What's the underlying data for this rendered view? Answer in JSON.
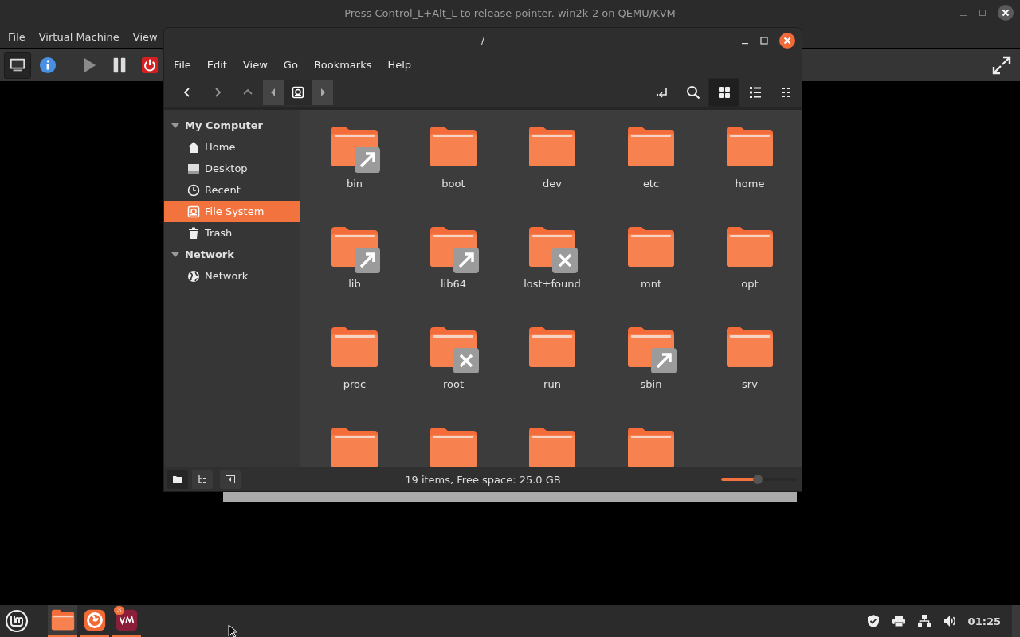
{
  "vm_window": {
    "title": "Press Control_L+Alt_L to release pointer. win2k-2 on QEMU/KVM",
    "menu": [
      "File",
      "Virtual Machine",
      "View"
    ],
    "toolbar": [
      {
        "kind": "console",
        "selected": true
      },
      {
        "kind": "info",
        "selected": false
      },
      {
        "kind": "run",
        "selected": false
      },
      {
        "kind": "pause",
        "selected": false
      },
      {
        "kind": "power",
        "selected": false
      }
    ]
  },
  "file_manager": {
    "title": "/",
    "menu": [
      "File",
      "Edit",
      "View",
      "Go",
      "Bookmarks",
      "Help"
    ],
    "view_modes": [
      {
        "kind": "icons",
        "selected": true
      },
      {
        "kind": "list",
        "selected": false
      },
      {
        "kind": "compact",
        "selected": false
      }
    ],
    "sidebar": [
      {
        "label": "My Computer",
        "expanded": true,
        "children": [
          {
            "label": "Home",
            "kind": "home",
            "selected": false
          },
          {
            "label": "Desktop",
            "kind": "desktop",
            "selected": false
          },
          {
            "label": "Recent",
            "kind": "recent",
            "selected": false
          },
          {
            "label": "File System",
            "kind": "drive",
            "selected": true
          },
          {
            "label": "Trash",
            "kind": "trash",
            "selected": false
          }
        ]
      },
      {
        "label": "Network",
        "expanded": true,
        "children": [
          {
            "label": "Network",
            "kind": "globe",
            "selected": false
          }
        ]
      }
    ],
    "items": [
      {
        "name": "bin",
        "kind": "symlink"
      },
      {
        "name": "boot",
        "kind": "plain"
      },
      {
        "name": "dev",
        "kind": "plain"
      },
      {
        "name": "etc",
        "kind": "plain"
      },
      {
        "name": "home",
        "kind": "plain"
      },
      {
        "name": "lib",
        "kind": "symlink"
      },
      {
        "name": "lib64",
        "kind": "symlink"
      },
      {
        "name": "lost+found",
        "kind": "locked"
      },
      {
        "name": "mnt",
        "kind": "plain"
      },
      {
        "name": "opt",
        "kind": "plain"
      },
      {
        "name": "proc",
        "kind": "plain"
      },
      {
        "name": "root",
        "kind": "locked"
      },
      {
        "name": "run",
        "kind": "plain"
      },
      {
        "name": "sbin",
        "kind": "symlink"
      },
      {
        "name": "srv",
        "kind": "plain"
      },
      {
        "kind": "plain"
      },
      {
        "kind": "plain"
      },
      {
        "kind": "plain"
      },
      {
        "kind": "plain"
      }
    ],
    "status": "19 items, Free space: 25.0 GB",
    "zoom": {
      "level": 0.48
    }
  },
  "taskbar": {
    "apps": [
      {
        "kind": "files",
        "selected": true
      },
      {
        "kind": "browser",
        "selected": false
      },
      {
        "kind": "vm",
        "selected": false,
        "badge": "3"
      }
    ],
    "tray": [
      {
        "kind": "shield"
      },
      {
        "kind": "printer"
      },
      {
        "kind": "network"
      },
      {
        "kind": "volume"
      }
    ],
    "clock": "01:25"
  }
}
